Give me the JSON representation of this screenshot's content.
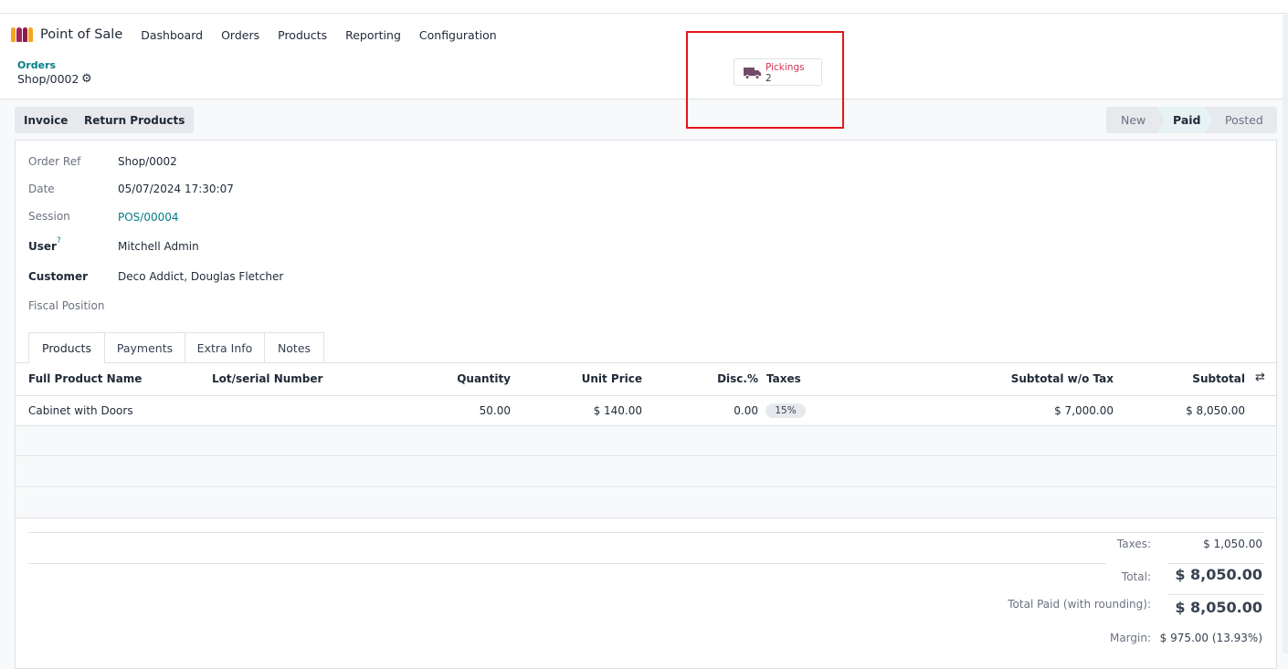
{
  "app": {
    "title": "Point of Sale",
    "menu": [
      "Dashboard",
      "Orders",
      "Products",
      "Reporting",
      "Configuration"
    ]
  },
  "breadcrumb": {
    "parent": "Orders",
    "current": "Shop/0002"
  },
  "smart_button": {
    "label": "Pickings",
    "count": "2",
    "icon": "truck-icon"
  },
  "actions": {
    "invoice": "Invoice",
    "return_products": "Return Products"
  },
  "statusbar": {
    "steps": [
      "New",
      "Paid",
      "Posted"
    ],
    "active": "Paid"
  },
  "fields": {
    "order_ref": {
      "label": "Order Ref",
      "value": "Shop/0002"
    },
    "date": {
      "label": "Date",
      "value": "05/07/2024 17:30:07"
    },
    "session": {
      "label": "Session",
      "value": "POS/00004"
    },
    "user": {
      "label": "User",
      "help": "?",
      "value": "Mitchell Admin"
    },
    "customer": {
      "label": "Customer",
      "value": "Deco Addict, Douglas Fletcher"
    },
    "fiscal_position": {
      "label": "Fiscal Position",
      "value": ""
    }
  },
  "tabs": [
    "Products",
    "Payments",
    "Extra Info",
    "Notes"
  ],
  "table": {
    "columns": [
      "Full Product Name",
      "Lot/serial Number",
      "Quantity",
      "Unit Price",
      "Disc.%",
      "Taxes",
      "Subtotal w/o Tax",
      "Subtotal"
    ],
    "rows": [
      {
        "name": "Cabinet with Doors",
        "lot": "",
        "qty": "50.00",
        "price": "$ 140.00",
        "disc": "0.00",
        "taxes": "15%",
        "subtotal_wo": "$ 7,000.00",
        "subtotal": "$ 8,050.00"
      }
    ]
  },
  "totals": {
    "taxes_label": "Taxes:",
    "taxes": "$ 1,050.00",
    "total_label": "Total:",
    "total": "$ 8,050.00",
    "paid_label": "Total Paid (with rounding):",
    "paid": "$ 8,050.00",
    "margin_label": "Margin:",
    "margin": "$ 975.00 (13.93%)"
  },
  "colors": {
    "accent": "#017e84",
    "smart_button_label": "#d63356",
    "annotation_box": "#e3151a"
  }
}
